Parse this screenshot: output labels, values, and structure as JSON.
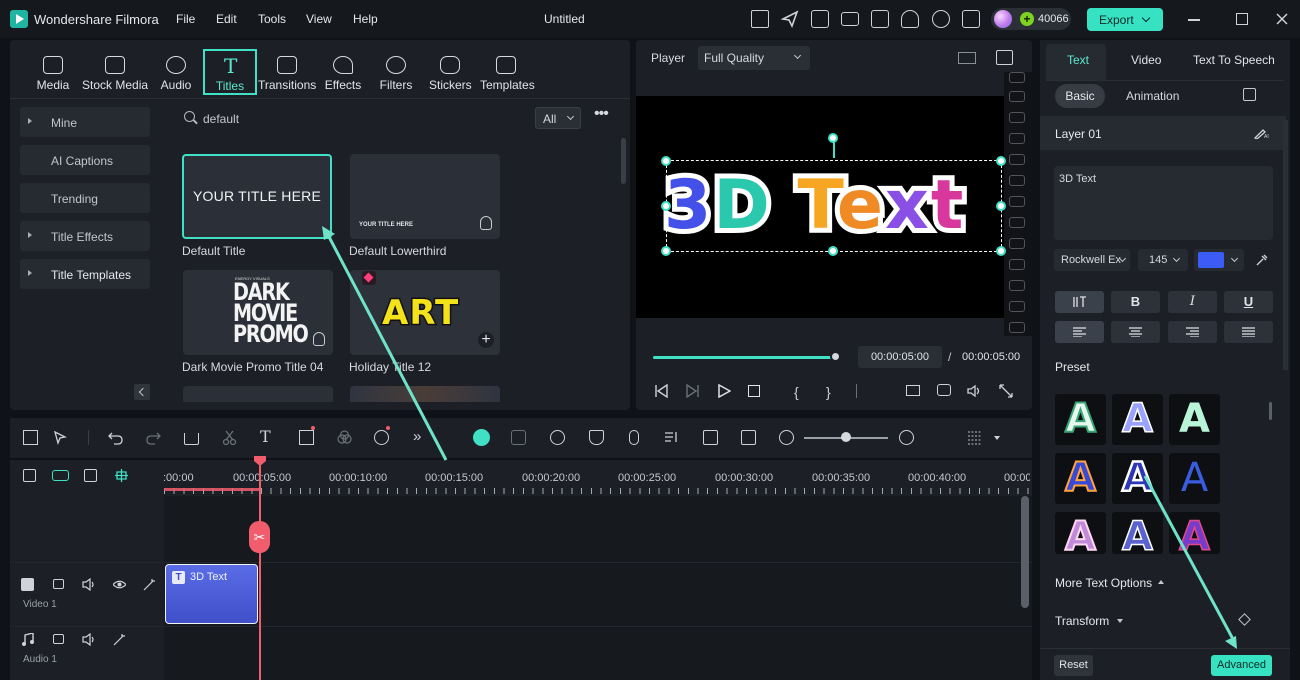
{
  "app": {
    "name": "Wondershare Filmora",
    "document_title": "Untitled",
    "credits": "40066",
    "export_label": "Export"
  },
  "menu": [
    "File",
    "Edit",
    "Tools",
    "View",
    "Help"
  ],
  "media_tabs": [
    {
      "label": "Media",
      "icon": "media-icon"
    },
    {
      "label": "Stock Media",
      "icon": "stock-media-icon"
    },
    {
      "label": "Audio",
      "icon": "audio-icon"
    },
    {
      "label": "Titles",
      "icon": "titles-icon",
      "active": true
    },
    {
      "label": "Transitions",
      "icon": "transitions-icon"
    },
    {
      "label": "Effects",
      "icon": "effects-icon"
    },
    {
      "label": "Filters",
      "icon": "filters-icon"
    },
    {
      "label": "Stickers",
      "icon": "stickers-icon"
    },
    {
      "label": "Templates",
      "icon": "templates-icon"
    }
  ],
  "sidebar": [
    {
      "label": "Mine",
      "arrow": true
    },
    {
      "label": "AI Captions",
      "arrow": false
    },
    {
      "label": "Trending",
      "arrow": false
    },
    {
      "label": "Title Effects",
      "arrow": true
    },
    {
      "label": "Title Templates",
      "arrow": true
    }
  ],
  "search": {
    "value": "default",
    "filter": "All"
  },
  "cards": [
    {
      "label": "Default Title",
      "thumb_text": "YOUR TITLE HERE"
    },
    {
      "label": "Default Lowerthird",
      "thumb_text": "YOUR TITLE HERE"
    },
    {
      "label": "Dark Movie Promo Title 04",
      "thumb_text": "DARK MOVIE PROMO",
      "thumb_small": "ENERGY VISUALS"
    },
    {
      "label": "Holiday Title 12",
      "thumb_text": "ART"
    }
  ],
  "player": {
    "label": "Player",
    "quality": "Full Quality",
    "preview_text": "3D Text",
    "current_time": "00:00:05:00",
    "separator": "/",
    "total_time": "00:00:05:00"
  },
  "properties": {
    "tabs": [
      "Text",
      "Video",
      "Text To Speech"
    ],
    "subtabs": [
      "Basic",
      "Animation"
    ],
    "layer": "Layer 01",
    "text_value": "3D Text",
    "font": "Rockwell Ex",
    "size": "145",
    "color": "#3d5bf5",
    "format_buttons": [
      "B",
      "I",
      "U"
    ],
    "preset_label": "Preset",
    "more_options": "More Text Options",
    "transform": "Transform",
    "reset": "Reset",
    "advanced": "Advanced"
  },
  "timeline": {
    "ticks": [
      ":00:00",
      "00:00:05:00",
      "00:00:10:00",
      "00:00:15:00",
      "00:00:20:00",
      "00:00:25:00",
      "00:00:30:00",
      "00:00:35:00",
      "00:00:40:00",
      "00:00:"
    ],
    "tracks": [
      {
        "name": "Video 1"
      },
      {
        "name": "Audio 1"
      }
    ],
    "clip_label": "3D Text"
  },
  "colors": {
    "accent": "#37e2c2",
    "playhead": "#f25d6e",
    "clip": "#4d5ed8"
  }
}
